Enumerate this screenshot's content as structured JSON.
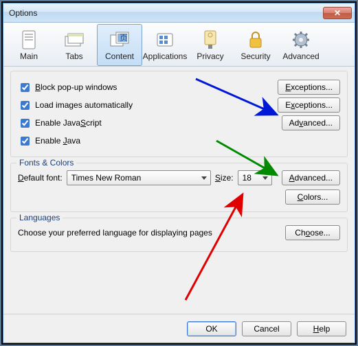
{
  "window": {
    "title": "Options"
  },
  "tabs": {
    "main": "Main",
    "tabs": "Tabs",
    "content": "Content",
    "applications": "Applications",
    "privacy": "Privacy",
    "security": "Security",
    "advanced": "Advanced"
  },
  "checks": {
    "block_popups": "Block pop-up windows",
    "load_images": "Load images automatically",
    "enable_js": "Enable JavaScript",
    "enable_java": "Enable Java"
  },
  "buttons": {
    "exceptions": "Exceptions...",
    "advanced": "Advanced...",
    "colors": "Colors...",
    "choose": "Choose...",
    "ok": "OK",
    "cancel": "Cancel",
    "help": "Help"
  },
  "fonts": {
    "group": "Fonts & Colors",
    "default_font_label": "Default font:",
    "font_value": "Times New Roman",
    "size_label": "Size:",
    "size_value": "18"
  },
  "lang": {
    "group": "Languages",
    "text": "Choose your preferred language for displaying pages"
  }
}
